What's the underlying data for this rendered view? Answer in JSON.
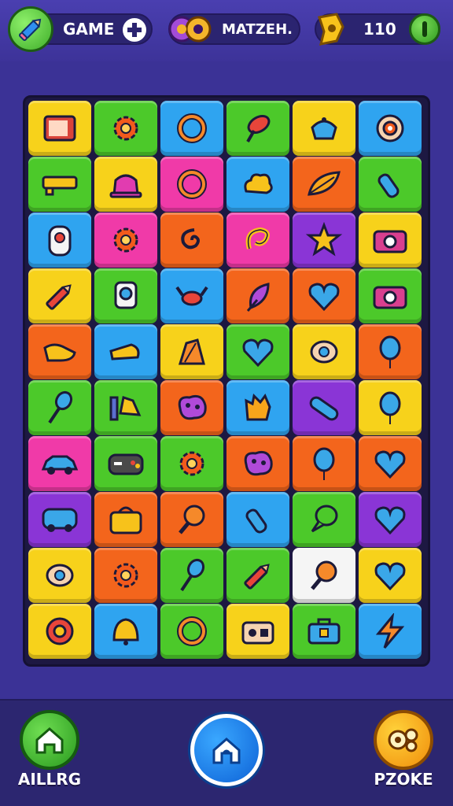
{
  "header": {
    "game_label": "GAME",
    "match_label": "MATZEH.",
    "score": "110"
  },
  "colors": {
    "yellow": "#f7d21b",
    "green": "#4cc92a",
    "blue": "#2fa4f0",
    "orange": "#f3651c",
    "pink": "#f03aa8",
    "purple": "#8a35d6",
    "white": "#f5f5f5",
    "background": "#3b3296"
  },
  "board": {
    "rows": [
      [
        {
          "color": "yellow",
          "icon": "tv-icon"
        },
        {
          "color": "green",
          "icon": "gear-icon"
        },
        {
          "color": "blue",
          "icon": "ring-icon"
        },
        {
          "color": "green",
          "icon": "pin-icon"
        },
        {
          "color": "yellow",
          "icon": "teapot-icon"
        },
        {
          "color": "blue",
          "icon": "donut-icon"
        }
      ],
      [
        {
          "color": "green",
          "icon": "tape-icon"
        },
        {
          "color": "yellow",
          "icon": "hat-icon"
        },
        {
          "color": "pink",
          "icon": "ring-icon"
        },
        {
          "color": "blue",
          "icon": "cloud-icon"
        },
        {
          "color": "orange",
          "icon": "leaf-icon"
        },
        {
          "color": "green",
          "icon": "bottle-icon"
        }
      ],
      [
        {
          "color": "blue",
          "icon": "robot-icon"
        },
        {
          "color": "pink",
          "icon": "gear-icon"
        },
        {
          "color": "orange",
          "icon": "swirl-icon"
        },
        {
          "color": "pink",
          "icon": "hook-icon"
        },
        {
          "color": "purple",
          "icon": "star-icon"
        },
        {
          "color": "yellow",
          "icon": "camera-icon"
        }
      ],
      [
        {
          "color": "yellow",
          "icon": "pencil-icon"
        },
        {
          "color": "green",
          "icon": "lens-icon"
        },
        {
          "color": "blue",
          "icon": "crab-icon"
        },
        {
          "color": "orange",
          "icon": "feather-icon"
        },
        {
          "color": "orange",
          "icon": "heart-icon"
        },
        {
          "color": "green",
          "icon": "camera-icon"
        }
      ],
      [
        {
          "color": "orange",
          "icon": "shoe-icon"
        },
        {
          "color": "blue",
          "icon": "whistle-icon"
        },
        {
          "color": "yellow",
          "icon": "tag-icon"
        },
        {
          "color": "green",
          "icon": "heart-icon"
        },
        {
          "color": "yellow",
          "icon": "egg-icon"
        },
        {
          "color": "orange",
          "icon": "balloon-icon"
        }
      ],
      [
        {
          "color": "green",
          "icon": "spoon-icon"
        },
        {
          "color": "green",
          "icon": "gadget-icon"
        },
        {
          "color": "orange",
          "icon": "blob-icon"
        },
        {
          "color": "blue",
          "icon": "hand-icon"
        },
        {
          "color": "purple",
          "icon": "capsule-icon"
        },
        {
          "color": "yellow",
          "icon": "balloon-icon"
        }
      ],
      [
        {
          "color": "pink",
          "icon": "car-icon"
        },
        {
          "color": "green",
          "icon": "gamepad-icon"
        },
        {
          "color": "green",
          "icon": "gear-icon"
        },
        {
          "color": "orange",
          "icon": "blob-icon"
        },
        {
          "color": "orange",
          "icon": "balloon-icon"
        },
        {
          "color": "orange",
          "icon": "heart-icon"
        }
      ],
      [
        {
          "color": "purple",
          "icon": "bus-icon"
        },
        {
          "color": "orange",
          "icon": "bag-icon"
        },
        {
          "color": "orange",
          "icon": "magnifier-icon"
        },
        {
          "color": "blue",
          "icon": "bottle-icon"
        },
        {
          "color": "green",
          "icon": "bubble-icon"
        },
        {
          "color": "purple",
          "icon": "heart-icon"
        }
      ],
      [
        {
          "color": "yellow",
          "icon": "egg-icon"
        },
        {
          "color": "orange",
          "icon": "gear-icon"
        },
        {
          "color": "green",
          "icon": "spoon-icon"
        },
        {
          "color": "green",
          "icon": "pencil-icon"
        },
        {
          "color": "white",
          "icon": "magnifier-icon"
        },
        {
          "color": "yellow",
          "icon": "heart-icon"
        }
      ],
      [
        {
          "color": "yellow",
          "icon": "lifebuoy-icon"
        },
        {
          "color": "blue",
          "icon": "bell-icon"
        },
        {
          "color": "green",
          "icon": "ring-icon"
        },
        {
          "color": "yellow",
          "icon": "radio-icon"
        },
        {
          "color": "green",
          "icon": "suitcase-icon"
        },
        {
          "color": "blue",
          "icon": "bolt-icon"
        }
      ]
    ]
  },
  "nav": {
    "left_label": "AILLRG",
    "right_label": "PZOKE"
  }
}
